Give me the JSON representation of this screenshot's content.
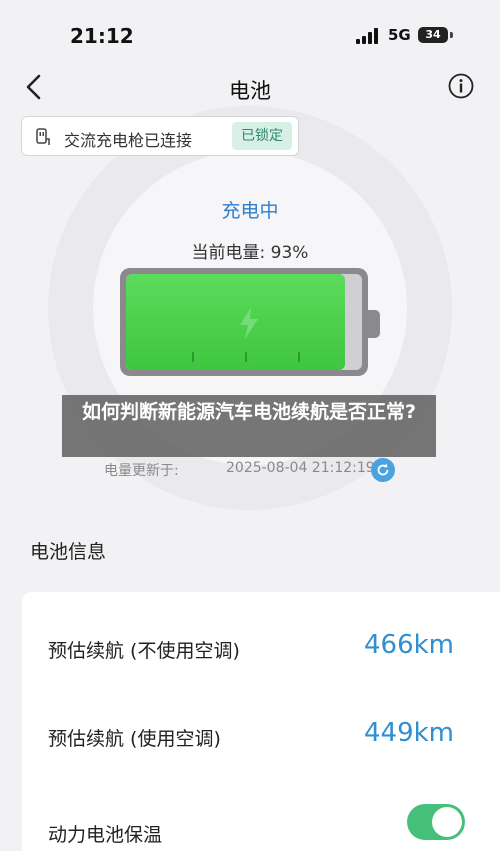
{
  "status_bar": {
    "time": "21:12",
    "network": "5G",
    "battery": "34"
  },
  "nav": {
    "title": "电池"
  },
  "charger": {
    "status": "交流充电枪已连接",
    "badge": "已锁定"
  },
  "battery": {
    "state": "充电中",
    "level_label": "当前电量: 93%",
    "level_percent": 93
  },
  "overlay": {
    "text": "如何判断新能源汽车电池续航是否正常?"
  },
  "update": {
    "label": "电量更新于:",
    "timestamp": "2025-08-04 21:12:19"
  },
  "section": {
    "title": "电池信息"
  },
  "info_rows": [
    {
      "label": "预估续航 (不使用空调)",
      "value": "466km"
    },
    {
      "label": "预估续航 (使用空调)",
      "value": "449km"
    },
    {
      "label": "动力电池保温",
      "toggle": true
    }
  ],
  "colors": {
    "accent_blue": "#2f8fd0",
    "charge_green": "#3fc63f",
    "toggle_green": "#45c07a",
    "badge_text": "#2d8a6b"
  },
  "icons": [
    "back-icon",
    "info-icon",
    "plug-icon",
    "lightning-icon",
    "refresh-icon",
    "signal-icon",
    "battery-icon"
  ]
}
